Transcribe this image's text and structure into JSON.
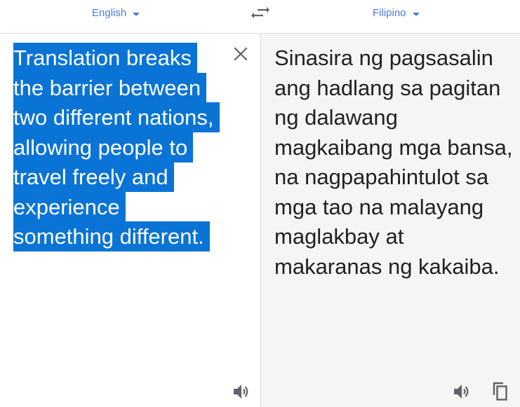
{
  "header": {
    "source_language": "English",
    "target_language": "Filipino",
    "source_caret_icon": "chevron-down-icon",
    "target_caret_icon": "chevron-down-icon",
    "swap_icon": "swap-arrows-icon"
  },
  "source": {
    "text": "Translation breaks the barrier between two different nations, allowing people to travel freely and experience something different.",
    "selected": true,
    "selection_color": "#0a74d6",
    "clear_icon": "close-icon",
    "listen_icon": "speaker-icon"
  },
  "target": {
    "text": "Sinasira ng pagsasalin ang hadlang sa pagitan ng dalawang magkaibang mga bansa, na nagpapahintulot sa mga tao na malayang maglakbay at makaranas ng kakaiba.",
    "listen_icon": "speaker-icon",
    "copy_icon": "copy-icon"
  },
  "colors": {
    "accent": "#4a7bd8",
    "target_background": "#f5f5f5",
    "divider": "#dadce0"
  }
}
